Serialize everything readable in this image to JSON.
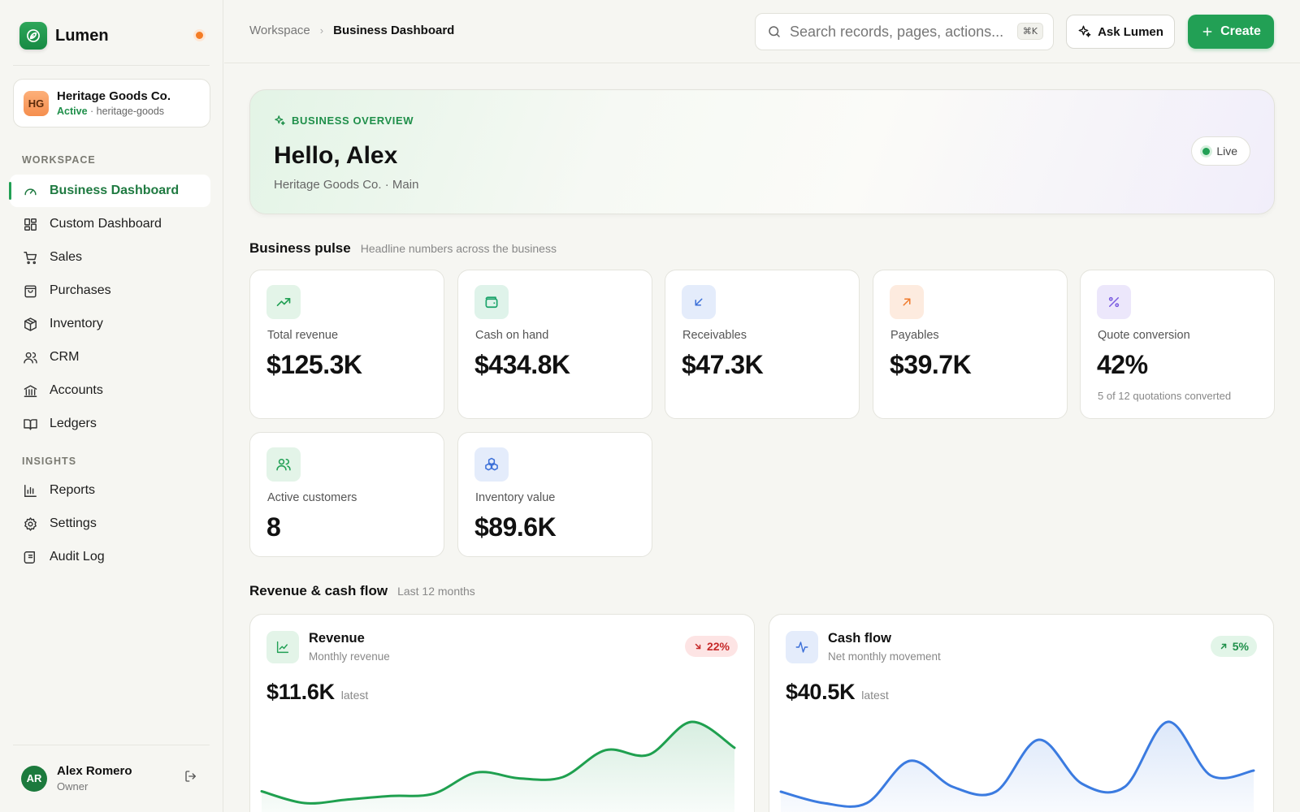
{
  "app": {
    "name": "Lumen"
  },
  "org": {
    "initials": "HG",
    "name": "Heritage Goods Co.",
    "status": "Active",
    "slug": "· heritage-goods"
  },
  "sidebar": {
    "workspace_label": "WORKSPACE",
    "workspace_items": [
      {
        "label": "Business Dashboard",
        "icon": "gauge-icon",
        "active": true
      },
      {
        "label": "Custom Dashboard",
        "icon": "grid-icon"
      },
      {
        "label": "Sales",
        "icon": "cart-icon"
      },
      {
        "label": "Purchases",
        "icon": "bag-icon"
      },
      {
        "label": "Inventory",
        "icon": "box-icon"
      },
      {
        "label": "CRM",
        "icon": "users-icon"
      },
      {
        "label": "Accounts",
        "icon": "bank-icon"
      },
      {
        "label": "Ledgers",
        "icon": "book-icon"
      }
    ],
    "insights_label": "INSIGHTS",
    "insights_items": [
      {
        "label": "Reports",
        "icon": "bar-chart-icon"
      },
      {
        "label": "Settings",
        "icon": "gear-icon"
      },
      {
        "label": "Audit Log",
        "icon": "scroll-icon"
      }
    ]
  },
  "user": {
    "initials": "AR",
    "name": "Alex Romero",
    "role": "Owner"
  },
  "topbar": {
    "breadcrumb": [
      "Workspace",
      "Business Dashboard"
    ],
    "search_placeholder": "Search records, pages, actions...",
    "search_shortcut": "⌘K",
    "ask_label": "Ask Lumen",
    "create_label": "Create"
  },
  "hero": {
    "eyebrow": "BUSINESS OVERVIEW",
    "greeting": "Hello, Alex",
    "subtitle": "Heritage Goods Co. · Main",
    "live_label": "Live"
  },
  "pulse": {
    "title": "Business pulse",
    "subtitle": "Headline numbers across the business",
    "kpis": [
      {
        "label": "Total revenue",
        "value": "$125.3K",
        "icon": "trending-up-icon",
        "color": "#22a055",
        "bg": "#e3f4e8"
      },
      {
        "label": "Cash on hand",
        "value": "$434.8K",
        "icon": "wallet-icon",
        "color": "#1aa36a",
        "bg": "#dff3ea"
      },
      {
        "label": "Receivables",
        "value": "$47.3K",
        "icon": "arrow-down-left-icon",
        "color": "#3b6fd8",
        "bg": "#e4ecfb"
      },
      {
        "label": "Payables",
        "value": "$39.7K",
        "icon": "arrow-up-right-icon",
        "color": "#f07a2c",
        "bg": "#fdebdf"
      },
      {
        "label": "Quote conversion",
        "value": "42%",
        "note": "5 of 12 quotations converted",
        "icon": "percent-icon",
        "color": "#7b5ce0",
        "bg": "#ece7fb"
      },
      {
        "label": "Active customers",
        "value": "8",
        "icon": "users-icon",
        "color": "#22a055",
        "bg": "#e3f4e8"
      },
      {
        "label": "Inventory value",
        "value": "$89.6K",
        "icon": "boxes-icon",
        "color": "#3b6fd8",
        "bg": "#e4ecfb"
      }
    ]
  },
  "flow": {
    "title": "Revenue & cash flow",
    "subtitle": "Last 12 months",
    "charts": [
      {
        "title": "Revenue",
        "subtitle": "Monthly revenue",
        "icon": "line-chart-icon",
        "badge": "22%",
        "badge_direction": "down",
        "value": "$11.6K",
        "value_label": "latest",
        "color": "#1fa04f",
        "fill": "#22a055",
        "series": [
          11.2,
          10.2,
          10.5,
          10.8,
          11.0,
          12.8,
          12.3,
          12.4,
          14.7,
          14.3,
          17.1,
          14.9
        ]
      },
      {
        "title": "Cash flow",
        "subtitle": "Net monthly movement",
        "icon": "activity-icon",
        "badge": "5%",
        "badge_direction": "up",
        "value": "$40.5K",
        "value_label": "latest",
        "color": "#3b7be0",
        "fill": "#3b7be0",
        "series": [
          5.0,
          -2.0,
          -2.0,
          24.0,
          8.0,
          5.0,
          37.0,
          10.0,
          8.0,
          48.0,
          15.0,
          18.0
        ]
      }
    ]
  }
}
